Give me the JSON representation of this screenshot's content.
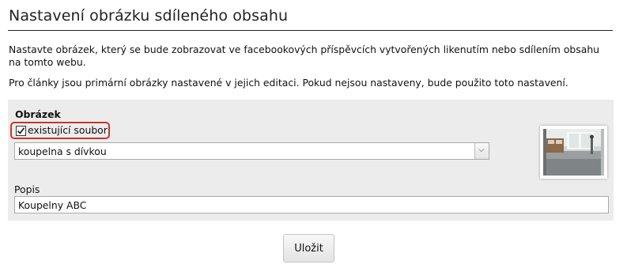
{
  "page": {
    "title": "Nastavení obrázku sdíleného obsahu",
    "intro": "Nastavte obrázek, který se bude zobrazovat ve facebookových příspěvcích vytvořených likenutím nebo sdílením obsahu na tomto webu.",
    "note": "Pro články jsou primární obrázky nastavené v jejich editaci. Pokud nejsou nastaveny, bude použito toto nastavení."
  },
  "form": {
    "image_label": "Obrázek",
    "existing_file_label": "existující soubor",
    "existing_file_checked": true,
    "image_select_value": "koupelna s dívkou",
    "thumbnail_icon": "image-thumbnail",
    "description_label": "Popis",
    "description_value": "Koupelny ABC"
  },
  "actions": {
    "save_label": "Uložit"
  },
  "colors": {
    "highlight_border": "#c0392b",
    "panel_background": "#ececec"
  }
}
